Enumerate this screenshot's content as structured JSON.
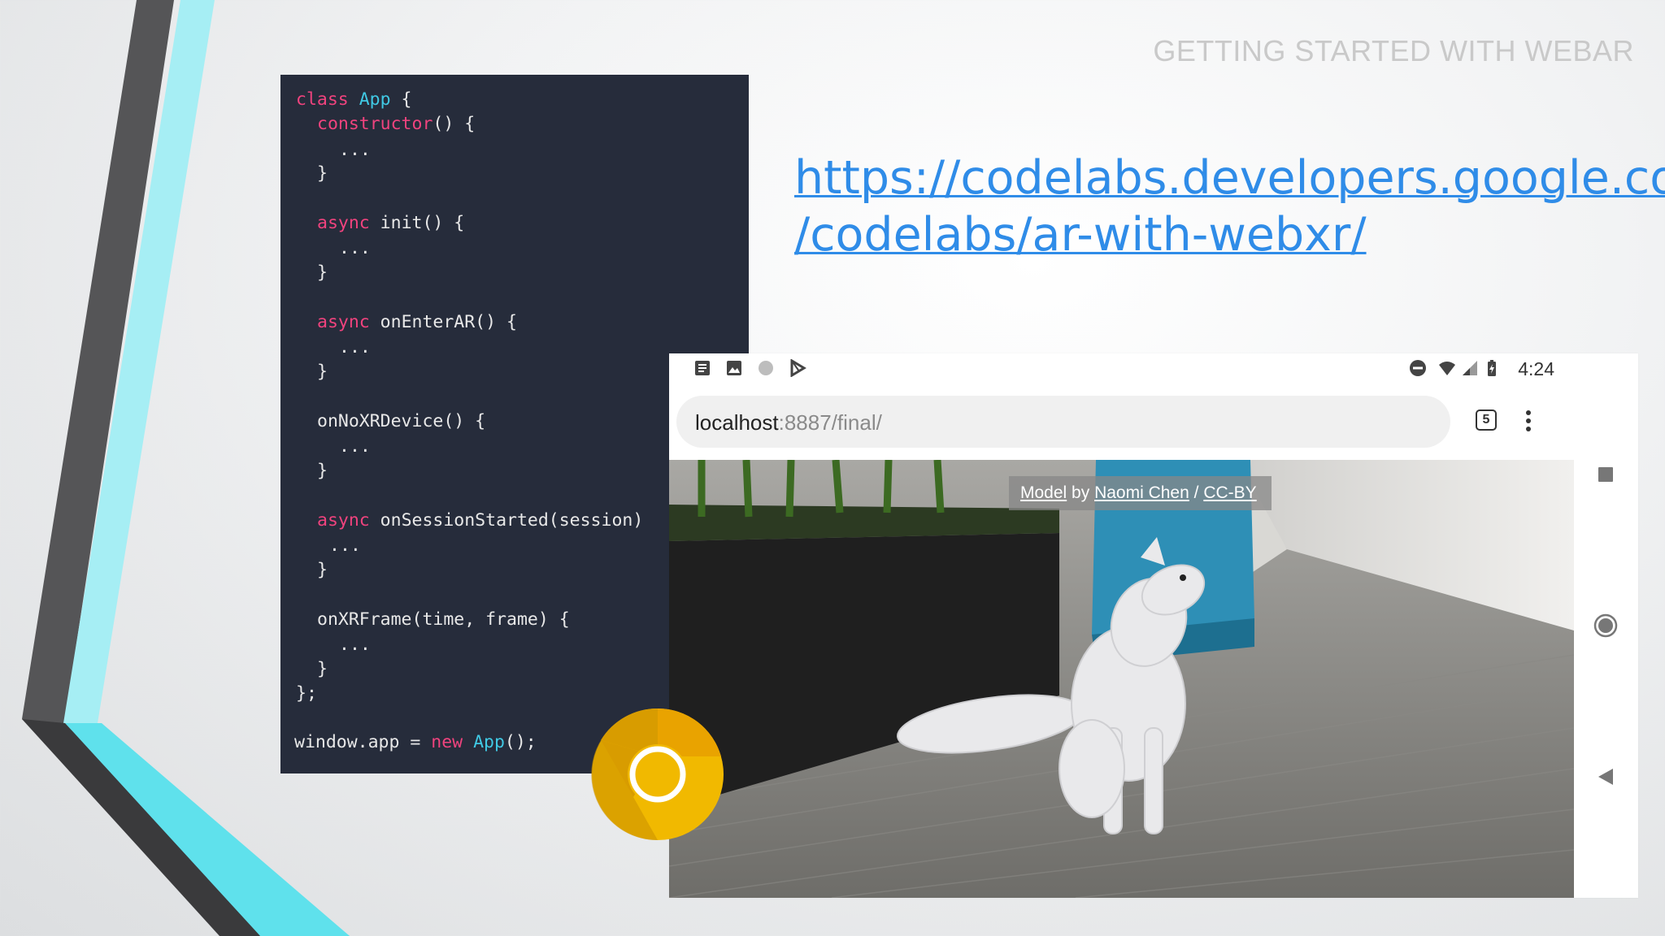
{
  "slide": {
    "title": "GETTING STARTED WITH WEBAR",
    "link_line1": "https://codelabs.developers.google.com",
    "link_line2": "/codelabs/ar-with-webxr/"
  },
  "code": {
    "l1_kw": "class",
    "l1_cls": "App",
    "l1_rest": " {",
    "l2_kw": "constructor",
    "l2_rest": "() {",
    "l3": "...",
    "l4": "}",
    "l6_kw": "async",
    "l6_rest": " init() {",
    "l7": "...",
    "l8": "}",
    "l10_kw": "async",
    "l10_rest": " onEnterAR() {",
    "l11": "...",
    "l12": "}",
    "l14": "onNoXRDevice() {",
    "l15": "...",
    "l16": "}",
    "l18_kw": "async",
    "l18_rest": " onSessionStarted(session)",
    "l19": "...",
    "l20": "}",
    "l22": "onXRFrame(time, frame) {",
    "l23": "...",
    "l24": "}",
    "l25": "};",
    "l27_a": "window.app = ",
    "l27_kw": "new",
    "l27_cls": "App",
    "l27_rest": "();"
  },
  "phone": {
    "status": {
      "time": "4:24",
      "left_icons": [
        "news-icon",
        "image-icon",
        "circle-icon",
        "play-store-icon"
      ],
      "right_icons": [
        "dnd-icon",
        "wifi-icon",
        "signal-icon",
        "battery-icon"
      ]
    },
    "browser": {
      "url_host": "localhost",
      "url_rest": ":8887/final/",
      "tab_count": "5"
    },
    "credit": {
      "model": "Model",
      "by": " by ",
      "author": "Naomi Chen",
      "sep": " / ",
      "license": "CC-BY"
    },
    "nav": [
      "recents-button",
      "home-button",
      "back-button"
    ]
  },
  "colors": {
    "code_bg": "#262c3b",
    "keyword": "#f0437e",
    "class_name": "#40c9e4",
    "link": "#2f8ce8",
    "accent_teal": "#5fe1ec",
    "chrome_yellow": "#f1b900"
  }
}
